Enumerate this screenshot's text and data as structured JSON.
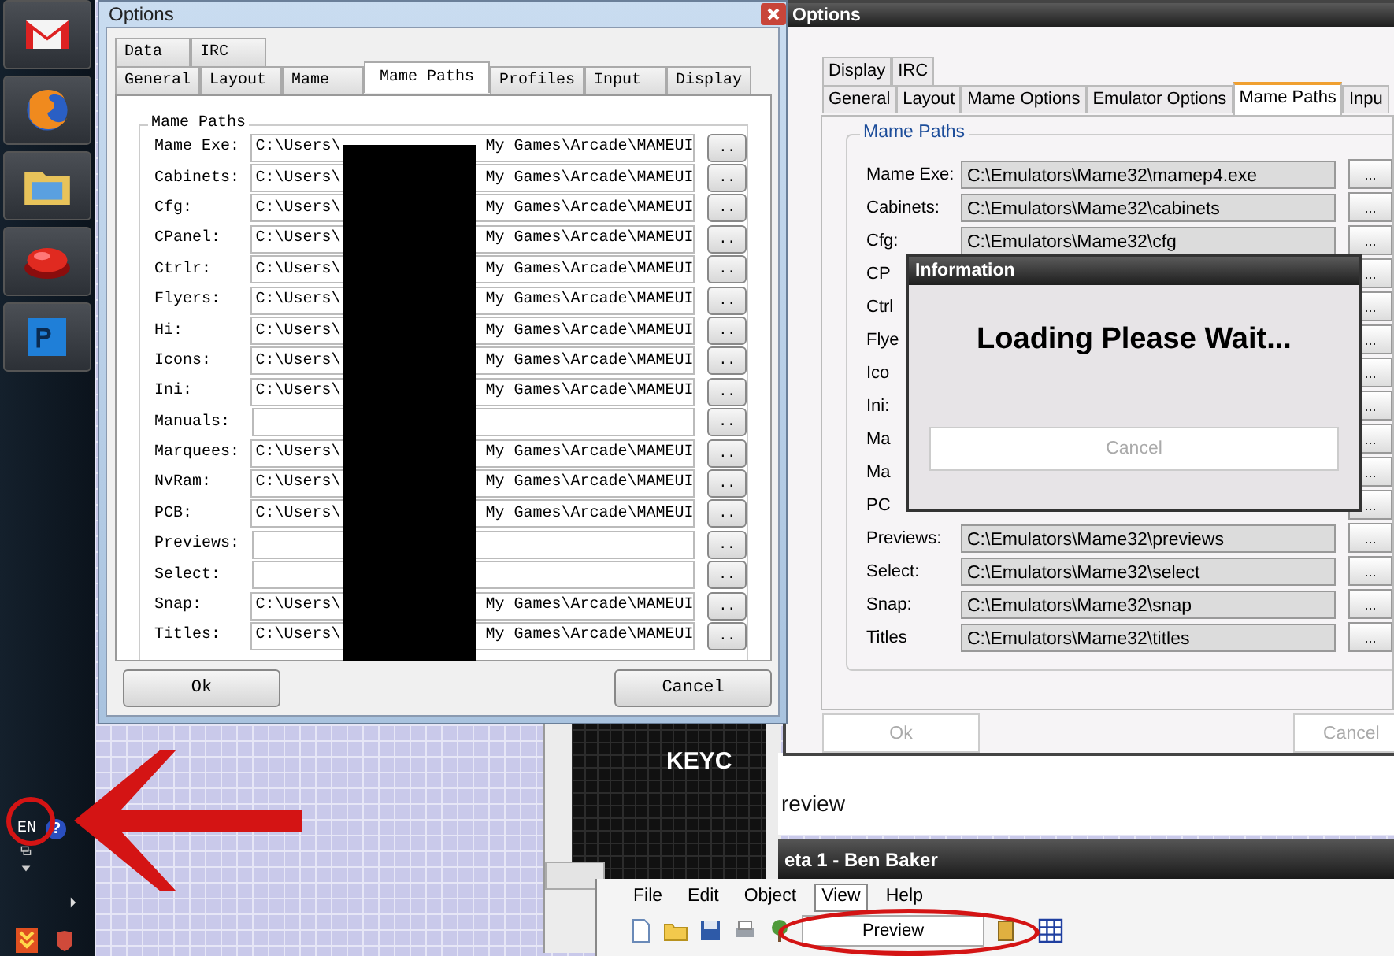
{
  "taskbar": {
    "language": "EN",
    "help": "?"
  },
  "left_dialog": {
    "title": "Options",
    "tab_rows": [
      [
        {
          "label": "Data",
          "selected": false
        },
        {
          "label": "IRC",
          "selected": false
        }
      ],
      [
        {
          "label": "General",
          "selected": false
        },
        {
          "label": "Layout",
          "selected": false
        },
        {
          "label": "Mame",
          "selected": false
        },
        {
          "label": "Mame Paths",
          "selected": true
        },
        {
          "label": "Profiles",
          "selected": false
        },
        {
          "label": "Input",
          "selected": false
        },
        {
          "label": "Display",
          "selected": false
        }
      ]
    ],
    "group": "Mame Paths",
    "rows": [
      {
        "label": "Mame Exe:",
        "value_start": "C:\\Users\\",
        "value_end": "My Games\\Arcade\\MAMEUI",
        "button": ".."
      },
      {
        "label": "Cabinets:",
        "value_start": "C:\\Users\\",
        "value_end": "My Games\\Arcade\\MAMEUI",
        "button": ".."
      },
      {
        "label": "Cfg:",
        "value_start": "C:\\Users\\",
        "value_end": "My Games\\Arcade\\MAMEUI",
        "button": ".."
      },
      {
        "label": "CPanel:",
        "value_start": "C:\\Users\\",
        "value_end": "My Games\\Arcade\\MAMEUI",
        "button": ".."
      },
      {
        "label": "Ctrlr:",
        "value_start": "C:\\Users\\",
        "value_end": "My Games\\Arcade\\MAMEUI",
        "button": ".."
      },
      {
        "label": "Flyers:",
        "value_start": "C:\\Users\\",
        "value_end": "My Games\\Arcade\\MAMEUI",
        "button": ".."
      },
      {
        "label": "Hi:",
        "value_start": "C:\\Users\\",
        "value_end": "My Games\\Arcade\\MAMEUI",
        "button": ".."
      },
      {
        "label": "Icons:",
        "value_start": "C:\\Users\\",
        "value_end": "My Games\\Arcade\\MAMEUI",
        "button": ".."
      },
      {
        "label": "Ini:",
        "value_start": "C:\\Users\\",
        "value_end": "My Games\\Arcade\\MAMEUI",
        "button": ".."
      },
      {
        "label": "Manuals:",
        "button": ".."
      },
      {
        "label": "Marquees:",
        "value_start": "C:\\Users\\",
        "value_end": "My Games\\Arcade\\MAMEUI",
        "button": ".."
      },
      {
        "label": "NvRam:",
        "value_start": "C:\\Users\\",
        "value_end": "My Games\\Arcade\\MAMEUI",
        "button": ".."
      },
      {
        "label": "PCB:",
        "value_start": "C:\\Users\\",
        "value_end": "My Games\\Arcade\\MAMEUI",
        "button": ".."
      },
      {
        "label": "Previews:",
        "button": ".."
      },
      {
        "label": "Select:",
        "button": ".."
      },
      {
        "label": "Snap:",
        "value_start": "C:\\Users\\",
        "value_end": "My Games\\Arcade\\MAMEUI",
        "button": ".."
      },
      {
        "label": "Titles:",
        "value_start": "C:\\Users\\",
        "value_end": "My Games\\Arcade\\MAMEUI",
        "button": ".."
      }
    ],
    "buttons": [
      "Ok",
      "Cancel"
    ]
  },
  "right_dialog": {
    "title": "Options",
    "tab_rows": [
      [
        {
          "label": "Display",
          "selected": false
        },
        {
          "label": "IRC",
          "selected": false
        }
      ],
      [
        {
          "label": "General",
          "selected": false
        },
        {
          "label": "Layout",
          "selected": false
        },
        {
          "label": "Mame Options",
          "selected": false
        },
        {
          "label": "Emulator Options",
          "selected": false
        },
        {
          "label": "Mame Paths",
          "selected": true
        },
        {
          "label": "Inpu",
          "selected": false
        }
      ]
    ],
    "group": "Mame Paths",
    "rows": [
      {
        "label": "Mame Exe:",
        "value": "C:\\Emulators\\Mame32\\mamep4.exe",
        "button": "..."
      },
      {
        "label": "Cabinets:",
        "value": "C:\\Emulators\\Mame32\\cabinets",
        "button": "..."
      },
      {
        "label": "Cfg:",
        "value": "C:\\Emulators\\Mame32\\cfg",
        "button": "..."
      },
      {
        "label": "CP",
        "button": "..."
      },
      {
        "label": "Ctrl",
        "button": "..."
      },
      {
        "label": "Flye",
        "button": "..."
      },
      {
        "label": "Ico",
        "button": "..."
      },
      {
        "label": "Ini:",
        "button": "..."
      },
      {
        "label": "Ma",
        "button": "..."
      },
      {
        "label": "Ma",
        "button": "..."
      },
      {
        "label": "PC",
        "button": "..."
      },
      {
        "label": "Previews:",
        "value": "C:\\Emulators\\Mame32\\previews",
        "button": "..."
      },
      {
        "label": "Select:",
        "value": "C:\\Emulators\\Mame32\\select",
        "button": "..."
      },
      {
        "label": "Snap:",
        "value": "C:\\Emulators\\Mame32\\snap",
        "button": "..."
      },
      {
        "label": "Titles",
        "value": "C:\\Emulators\\Mame32\\titles",
        "button": "..."
      }
    ],
    "buttons": [
      {
        "label": "Ok",
        "disabled": true
      },
      {
        "label": "Cancel",
        "disabled": true
      }
    ]
  },
  "info_dialog": {
    "title": "Information",
    "message": "Loading Please Wait...",
    "button": {
      "label": "Cancel",
      "disabled": true
    }
  },
  "canvas_window": {
    "text": "KEYC"
  },
  "preview_panel": {
    "title": "review"
  },
  "editor_window": {
    "title": "eta 1 - Ben Baker",
    "menu": [
      {
        "label": "File",
        "selected": false
      },
      {
        "label": "Edit",
        "selected": false
      },
      {
        "label": "Object",
        "selected": false
      },
      {
        "label": "View",
        "selected": true
      },
      {
        "label": "Help",
        "selected": false
      }
    ],
    "dropdown": "Preview"
  }
}
